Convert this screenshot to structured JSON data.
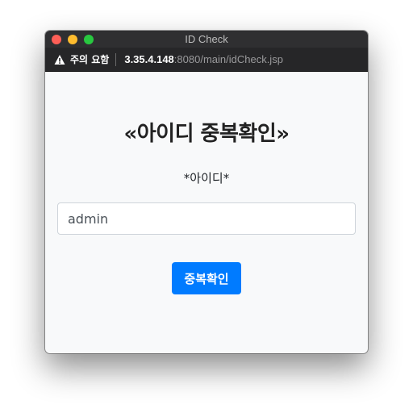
{
  "window": {
    "title": "ID Check"
  },
  "addressbar": {
    "warning_icon": "warning-triangle-icon",
    "warning_text": "주의 요함",
    "url_host": "3.35.4.148",
    "url_path": ":8080/main/idCheck.jsp"
  },
  "main": {
    "heading": "«아이디 중복확인»",
    "id_label": "*아이디*",
    "id_value": "admin",
    "check_button": "중복확인"
  },
  "colors": {
    "button": "#007bff",
    "background": "#f8f9fa"
  }
}
